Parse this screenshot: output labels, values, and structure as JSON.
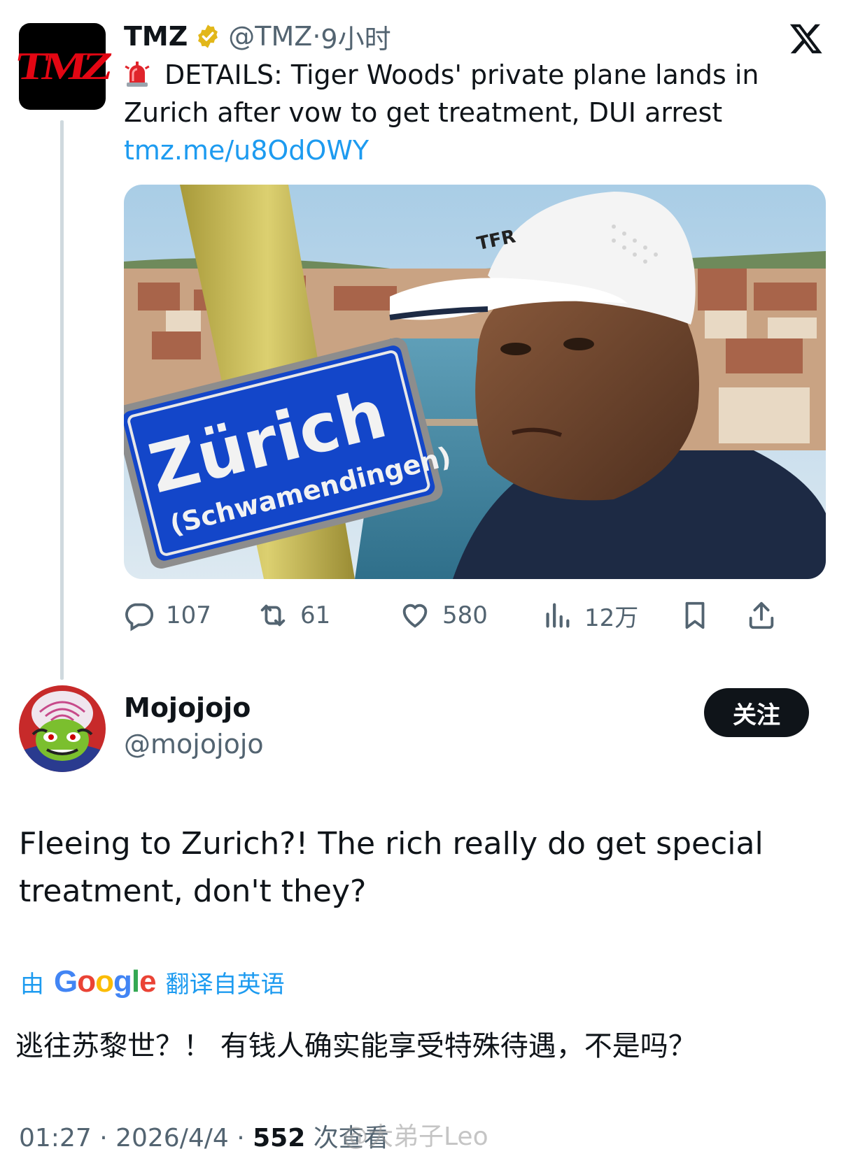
{
  "quoted": {
    "avatar_text": "TMZ",
    "name": "TMZ",
    "handle": "@TMZ",
    "separator": "·",
    "time": "9小时",
    "text": "DETAILS: Tiger Woods' private plane lands in Zurich after vow to get treatment, DUI arrest",
    "link": "tmz.me/u8OdOWY",
    "image": {
      "sign_title": "Zürich",
      "sign_subtitle": "(Schwamendingen)"
    },
    "stats": {
      "replies": "107",
      "reposts": "61",
      "likes": "580",
      "views": "12万"
    }
  },
  "reply": {
    "name": "Mojojojo",
    "handle": "@mojojojo",
    "follow_label": "关注",
    "text": "Fleeing to Zurich?! The rich really do get special treatment, don't they?",
    "translate_prefix": "由",
    "translate_brand": "Google",
    "translate_suffix": "翻译自英语",
    "translated_text": "逃往苏黎世？！ 有钱人确实能享受特殊待遇，不是吗？",
    "time": "01:27",
    "date": "2026/4/4",
    "views": "552",
    "views_label": "次查看"
  },
  "watermark": "@大弟子Leo",
  "colors": {
    "accent": "#1d9bf0",
    "text": "#0f1419",
    "muted": "#536471",
    "verified_gold": "#e2b719",
    "tmz_red": "#e30613"
  },
  "icons": [
    "x-logo-icon",
    "verified-gold-icon",
    "siren-emoji-icon",
    "reply-icon",
    "repost-icon",
    "like-icon",
    "views-icon",
    "bookmark-icon",
    "share-icon"
  ]
}
